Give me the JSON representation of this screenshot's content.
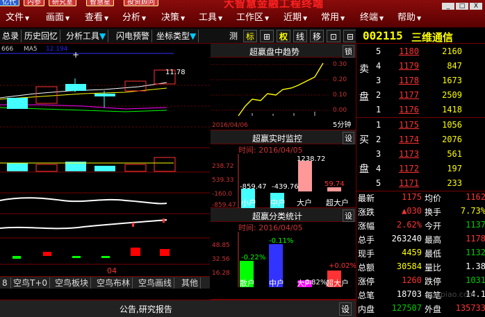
{
  "app_title": "大智慧金融工程终端",
  "tags": [
    "亿代",
    "内参",
    "研究室",
    "智慧星",
    "投资顾问"
  ],
  "window_controls": [
    "_",
    "□",
    "X"
  ],
  "menu": [
    "文件",
    "画面",
    "查看",
    "分析",
    "决策",
    "工具",
    "工作区",
    "近期",
    "常用",
    "终端",
    "帮助"
  ],
  "toolbar": {
    "items": [
      "总录",
      "历史回忆",
      "分析工具",
      "闪电预警",
      "坐标类型"
    ],
    "icons": [
      "测",
      "标",
      "⊞",
      "权",
      "线",
      "移",
      "⊡",
      "⊟"
    ]
  },
  "stock": {
    "code": "002115",
    "name": "三维通信"
  },
  "kline": {
    "ma_label": "666",
    "ma_name": "MA5",
    "ma_value": "12.194",
    "high_label": "11.78",
    "date_label": "04"
  },
  "bottom_tabs": [
    "空鸟T+0",
    "空鸟板块",
    "空鸟布林",
    "空鸟画线",
    "其他"
  ],
  "announce": {
    "title": "公告,研究报告",
    "set": "设"
  },
  "panel_trend": {
    "title": "超赢盘中趋势",
    "lock": "锁",
    "date": "2016/04/06",
    "footer": "5分钟",
    "ticks": [
      "0.30",
      "0.20",
      "0.10",
      "0.00",
      "-0.10"
    ]
  },
  "panel_monitor": {
    "title": "超赢实时监控",
    "set": "设",
    "date": "时间: 2016/04/05",
    "yticks": [
      "238.72",
      "539.33",
      "-160.0",
      "-859.47"
    ],
    "labels": [
      "-859.47",
      "-439.76",
      "1238.72",
      "59.74"
    ],
    "cats": [
      "小户",
      "中户",
      "大户",
      "超大户"
    ]
  },
  "panel_stats": {
    "title": "超赢分类统计",
    "set": "设",
    "date": "时间: 2016/04/05",
    "yticks": [
      "48.85",
      "32.56",
      "16.28"
    ],
    "labels": [
      "-0.22%",
      "-0.11%",
      "-0.82%",
      "+0.02%"
    ],
    "cats": [
      "散户",
      "中户",
      "大户",
      "超大户"
    ]
  },
  "sell": [
    {
      "n": "5",
      "p": "1180",
      "v": "2160"
    },
    {
      "n": "4",
      "p": "1179",
      "v": "847"
    },
    {
      "n": "3",
      "p": "1178",
      "v": "1673"
    },
    {
      "n": "2",
      "p": "1177",
      "v": "2509"
    },
    {
      "n": "1",
      "p": "1176",
      "v": "1418"
    }
  ],
  "buy": [
    {
      "n": "1",
      "p": "1175",
      "v": "1056"
    },
    {
      "n": "2",
      "p": "1174",
      "v": "2076"
    },
    {
      "n": "3",
      "p": "1173",
      "v": "561"
    },
    {
      "n": "4",
      "p": "1172",
      "v": "197"
    },
    {
      "n": "5",
      "p": "1171",
      "v": "233"
    }
  ],
  "sell_side": [
    "卖",
    "盘"
  ],
  "buy_side": [
    "买",
    "盘"
  ],
  "stats": [
    {
      "l": "最新",
      "v": "1175",
      "l2": "均价",
      "v2": "1162"
    },
    {
      "l": "涨跌",
      "v": "▲030",
      "l2": "换手",
      "v2": "7.73%"
    },
    {
      "l": "涨幅",
      "v": "2.62%",
      "l2": "今开",
      "v2": "1137"
    },
    {
      "l": "总手",
      "v": "263240",
      "l2": "最高",
      "v2": "1178"
    },
    {
      "l": "现手",
      "v": "4459",
      "l2": "最低",
      "v2": "1132"
    },
    {
      "l": "总额",
      "v": "30584",
      "l2": "量比",
      "v2": "1.38"
    },
    {
      "l": "涨停",
      "v": "1260",
      "l2": "跌停",
      "v2": "1031"
    },
    {
      "l": "总笔",
      "v": "18703",
      "l2": "每笔",
      "v2": "14.1"
    },
    {
      "l": "内盘",
      "v": "127507",
      "l2": "外盘",
      "v2": "135733"
    }
  ],
  "watermark": "gupiao.com"
}
